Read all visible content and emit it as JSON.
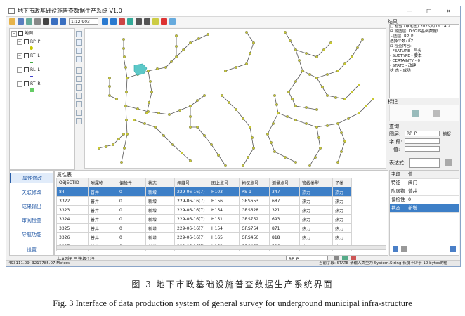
{
  "window": {
    "title": "地下市政基础设施普查数据生产系统 V1.0",
    "buttons": "— □ ×"
  },
  "toolbar": {
    "scale_value": "1:12,903"
  },
  "layer_tree": {
    "root": "地图",
    "layers": [
      {
        "name": "RP_P",
        "symbol_color": "#c8c800"
      },
      {
        "name": "RT_L",
        "symbol_color": "#44aa44"
      },
      {
        "name": "RL_L",
        "symbol_color": "#4444cc"
      },
      {
        "name": "RT_R",
        "symbol_color": "#66cc66"
      }
    ]
  },
  "results_panel": {
    "title": "结果",
    "lines": [
      "□ 检查 (审定图)  2025/6/16 14:2",
      "  ⊟ 源图层: D:\\GIS基础数据\\",
      "      └ 图层: RP_P",
      "      选择个数: 87",
      "  ⊟ 检查内容:",
      "      · FEATURE - 号头",
      "      · SUBTYPE - 要本",
      "      · CERTAINTY - 0",
      "      · STATE - 改建",
      "    状    态 - 成功"
    ]
  },
  "mark_panel": {
    "title": "标记"
  },
  "query_panel": {
    "title": "查询",
    "layer_label": "图层:",
    "layer_value": "RP_P",
    "capture_label": "捕捉",
    "field_label": "字  段:",
    "value_label": "值:",
    "expr_label": "表达式:"
  },
  "left_nav": {
    "items": [
      "属性修改",
      "关联修改",
      "成果输出",
      "审阅检查",
      "导航功能"
    ],
    "bottom": "设置"
  },
  "attribute_table": {
    "title": "属性表",
    "columns": [
      "OBJECTID",
      "附属物",
      "偏检性",
      "状态",
      "埋藏号",
      "图上点号",
      "物探点号",
      "测量点号",
      "管线类型",
      "子类"
    ],
    "rows": [
      [
        "84",
        "普井",
        "0",
        "新增",
        "229-06-16(7)",
        "H103",
        "RS-1",
        "347",
        "热力",
        "热力"
      ],
      [
        "3322",
        "普井",
        "0",
        "新增",
        "229-06-16(7)",
        "H156",
        "GRS653",
        "687",
        "热力",
        "热力"
      ],
      [
        "3323",
        "普井",
        "0",
        "新增",
        "229-06-16(7)",
        "H154",
        "GRS628",
        "321",
        "热力",
        "热力"
      ],
      [
        "3324",
        "普井",
        "0",
        "新增",
        "229-06-16(7)",
        "H151",
        "GRS752",
        "693",
        "热力",
        "热力"
      ],
      [
        "3325",
        "普井",
        "0",
        "新增",
        "229-06-16(7)",
        "H154",
        "GRS754",
        "871",
        "热力",
        "热力"
      ],
      [
        "3326",
        "普井",
        "0",
        "新增",
        "229-06-16(7)",
        "H165",
        "GRS456",
        "818",
        "热力",
        "热力"
      ],
      [
        "3327",
        "普井",
        "0",
        "新增",
        "229-06-16(7)",
        "H163",
        "GRS468",
        "526",
        "热力",
        "热力"
      ]
    ]
  },
  "table_footer": {
    "count_text": "共87行  已选择1行",
    "layer": "RP_P"
  },
  "properties": {
    "header": [
      "字段",
      "值"
    ],
    "rows": [
      [
        "特征",
        "阀门"
      ],
      [
        "附属物",
        "普井"
      ],
      [
        "偏检性",
        "0"
      ],
      [
        "状态",
        "新增"
      ]
    ],
    "selected_index": 3
  },
  "status_bar": {
    "coords": "493111.09, 3217785.07  Meters",
    "message": "当前字段: STATE 请输入类型为 System.String 长度不少于 10 bytes的值"
  },
  "captions": {
    "cn": "图 3   地下市政基础设施普查数据生产系统界面",
    "en": "Fig. 3   Interface of data production system of general survey for underground municipal infra-structure"
  },
  "colors": {
    "accent": "#2a5ea8",
    "selection": "#3d7fc7",
    "map_points": "#c8c832"
  }
}
